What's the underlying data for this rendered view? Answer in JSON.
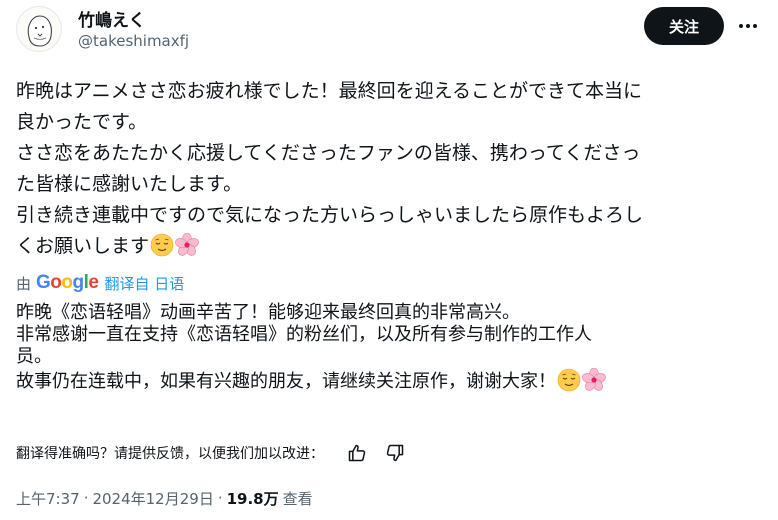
{
  "user": {
    "display_name": "竹嶋えく",
    "handle": "@takeshimaxfj"
  },
  "actions": {
    "follow_label": "关注",
    "more_icon": "more-horizontal-icon"
  },
  "tweet": {
    "lines": [
      "昨晩はアニメささ恋お疲れ様でした！最終回を迎えることができて本当に",
      "良かったです。",
      "ささ恋をあたたかく応援してくださったファンの皆様、携わってくださっ",
      "た皆様に感謝いたします。",
      "引き続き連載中ですので気になった方いらっしゃいましたら原作もよろし",
      "くお願いします"
    ],
    "emojis": [
      "relieved-face-emoji",
      "cherry-blossom-emoji"
    ]
  },
  "translation": {
    "by_label": "由",
    "provider": "Google",
    "link_label": "翻译自 日语",
    "lines": [
      "昨晚《恋语轻唱》动画辛苦了！能够迎来最终回真的非常高兴。",
      "非常感谢一直在支持《恋语轻唱》的粉丝们，以及所有参与制作的工作人",
      "员。",
      "故事仍在连载中，如果有兴趣的朋友，请继续关注原作，谢谢大家！"
    ],
    "feedback_prompt": "翻译得准确吗？请提供反馈，以便我们加以改进：",
    "feedback_icons": [
      "thumbs-up-icon",
      "thumbs-down-icon"
    ]
  },
  "meta": {
    "time": "上午7:37",
    "separator": "·",
    "date": "2024年12月29日",
    "views_count": "19.8万",
    "views_label": "查看"
  },
  "colors": {
    "text": "#0f1419",
    "secondary": "#536471",
    "link": "#1d9bf0",
    "follow_bg": "#0f1419"
  }
}
